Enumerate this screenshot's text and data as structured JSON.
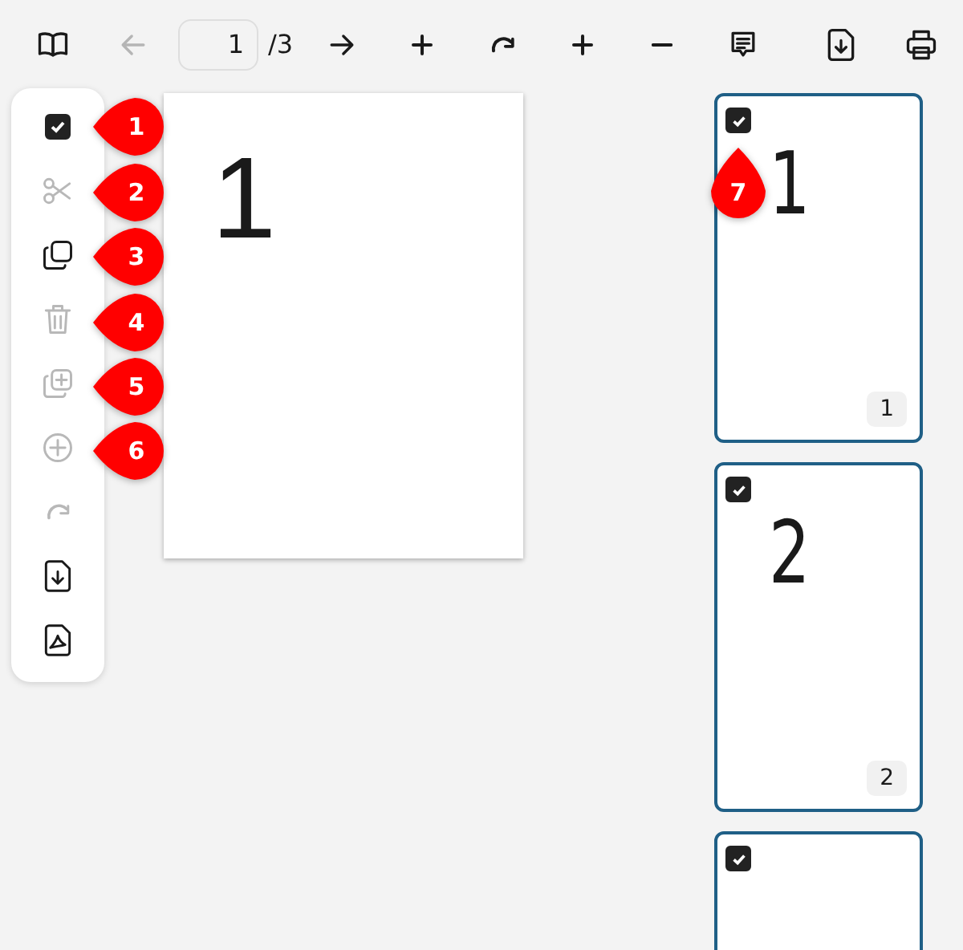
{
  "toolbar": {
    "buttons": [
      {
        "disabled": false
      },
      {
        "disabled": true
      },
      {
        "disabled": false
      },
      {
        "disabled": false
      },
      {
        "disabled": false
      },
      {
        "disabled": false
      },
      {
        "disabled": false
      },
      {
        "disabled": false
      }
    ],
    "page_field": {
      "value": "1"
    },
    "page_total": "/3",
    "right_buttons": [
      {
        "disabled": false
      },
      {
        "disabled": false
      }
    ]
  },
  "tools": [
    {
      "kind": "checkbox",
      "checked": true
    },
    {
      "kind": "icon",
      "disabled": true
    },
    {
      "kind": "icon",
      "disabled": false
    },
    {
      "kind": "icon",
      "disabled": true
    },
    {
      "kind": "icon",
      "disabled": true
    },
    {
      "kind": "icon",
      "disabled": true
    },
    {
      "kind": "icon",
      "disabled": true
    },
    {
      "kind": "icon",
      "disabled": false
    },
    {
      "kind": "icon",
      "disabled": false
    }
  ],
  "markers": [
    {
      "label": "1",
      "kind": "left"
    },
    {
      "label": "2",
      "kind": "left"
    },
    {
      "label": "3",
      "kind": "left"
    },
    {
      "label": "4",
      "kind": "left"
    },
    {
      "label": "5",
      "kind": "left"
    },
    {
      "label": "6",
      "kind": "left"
    },
    {
      "label": "7",
      "kind": "up"
    }
  ],
  "page": {
    "text": "1"
  },
  "thumbnails": [
    {
      "text": "1",
      "number": "1",
      "selected": true,
      "checked": true
    },
    {
      "text": "2",
      "number": "2",
      "selected": true,
      "checked": true
    },
    {
      "selected": true,
      "checked": true
    }
  ]
}
